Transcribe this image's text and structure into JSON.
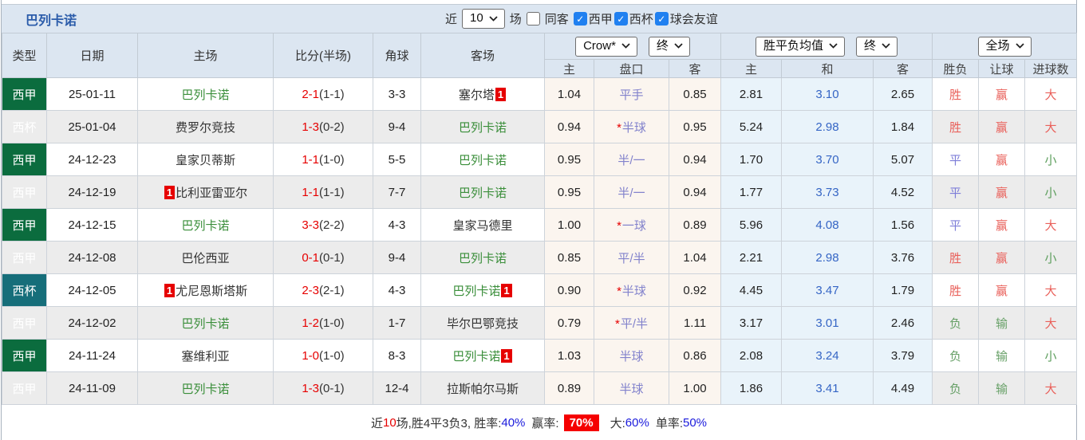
{
  "title": "巴列卡诺",
  "topbar": {
    "recent_label": "近",
    "recent_count": "10",
    "games_label": "场",
    "same_away_label": "同客",
    "filters": [
      {
        "label": "西甲",
        "checked": true
      },
      {
        "label": "西杯",
        "checked": true
      },
      {
        "label": "球会友谊",
        "checked": true
      }
    ]
  },
  "header": {
    "columns": [
      "类型",
      "日期",
      "主场",
      "比分(半场)",
      "角球",
      "客场"
    ],
    "odds_source_select": "Crow*",
    "odds_time_select": "终",
    "avg_select": "胜平负均值",
    "avg_time_select": "终",
    "scope_select": "全场",
    "sub_columns": [
      "主",
      "盘口",
      "客",
      "主",
      "和",
      "客",
      "胜负",
      "让球",
      "进球数"
    ]
  },
  "colors": {
    "laliga_badge": "#0b6c3e",
    "copa_badge": "#166e7a",
    "team_highlight": "#3a8e3a",
    "score_red": "#e60000",
    "handicap_text": "#8282cc",
    "avg_draw_blue": "#3565c5",
    "win_red": "#e9605a",
    "draw_blue": "#7d7dd8",
    "lose_green": "#67a067",
    "percent_blue": "#1a1adc",
    "badge_red": "#f50000"
  },
  "rows": [
    {
      "league": "西甲",
      "type": "liga",
      "date": "25-01-11",
      "home": "巴列卡诺",
      "home_hl": true,
      "home_card": "",
      "score": "2-1",
      "half": "(1-1)",
      "corners": "3-3",
      "away": "塞尔塔",
      "away_hl": false,
      "away_card": "1",
      "odds_home": "1.04",
      "handicap": "平手",
      "star": false,
      "odds_away": "0.85",
      "avg_home": "2.81",
      "avg_draw": "3.10",
      "avg_away": "2.65",
      "result": "胜",
      "result_cls": "win",
      "handicap_result": "赢",
      "handicap_cls": "win",
      "goals": "大",
      "goals_cls": "big"
    },
    {
      "league": "西杯",
      "type": "copa",
      "date": "25-01-04",
      "home": "费罗尔竞技",
      "home_hl": false,
      "home_card": "",
      "score": "1-3",
      "half": "(0-2)",
      "corners": "9-4",
      "away": "巴列卡诺",
      "away_hl": true,
      "away_card": "",
      "odds_home": "0.94",
      "handicap": "半球",
      "star": true,
      "odds_away": "0.95",
      "avg_home": "5.24",
      "avg_draw": "2.98",
      "avg_away": "1.84",
      "result": "胜",
      "result_cls": "win",
      "handicap_result": "赢",
      "handicap_cls": "win",
      "goals": "大",
      "goals_cls": "big"
    },
    {
      "league": "西甲",
      "type": "liga",
      "date": "24-12-23",
      "home": "皇家贝蒂斯",
      "home_hl": false,
      "home_card": "",
      "score": "1-1",
      "half": "(1-0)",
      "corners": "5-5",
      "away": "巴列卡诺",
      "away_hl": true,
      "away_card": "",
      "odds_home": "0.95",
      "handicap": "半/一",
      "star": false,
      "odds_away": "0.94",
      "avg_home": "1.70",
      "avg_draw": "3.70",
      "avg_away": "5.07",
      "result": "平",
      "result_cls": "draw",
      "handicap_result": "赢",
      "handicap_cls": "win",
      "goals": "小",
      "goals_cls": "small"
    },
    {
      "league": "西甲",
      "type": "liga",
      "date": "24-12-19",
      "home": "比利亚雷亚尔",
      "home_hl": false,
      "home_card": "1",
      "score": "1-1",
      "half": "(1-1)",
      "corners": "7-7",
      "away": "巴列卡诺",
      "away_hl": true,
      "away_card": "",
      "odds_home": "0.95",
      "handicap": "半/一",
      "star": false,
      "odds_away": "0.94",
      "avg_home": "1.77",
      "avg_draw": "3.73",
      "avg_away": "4.52",
      "result": "平",
      "result_cls": "draw",
      "handicap_result": "赢",
      "handicap_cls": "win",
      "goals": "小",
      "goals_cls": "small"
    },
    {
      "league": "西甲",
      "type": "liga",
      "date": "24-12-15",
      "home": "巴列卡诺",
      "home_hl": true,
      "home_card": "",
      "score": "3-3",
      "half": "(2-2)",
      "corners": "4-3",
      "away": "皇家马德里",
      "away_hl": false,
      "away_card": "",
      "odds_home": "1.00",
      "handicap": "一球",
      "star": true,
      "odds_away": "0.89",
      "avg_home": "5.96",
      "avg_draw": "4.08",
      "avg_away": "1.56",
      "result": "平",
      "result_cls": "draw",
      "handicap_result": "赢",
      "handicap_cls": "win",
      "goals": "大",
      "goals_cls": "big"
    },
    {
      "league": "西甲",
      "type": "liga",
      "date": "24-12-08",
      "home": "巴伦西亚",
      "home_hl": false,
      "home_card": "",
      "score": "0-1",
      "half": "(0-1)",
      "corners": "9-4",
      "away": "巴列卡诺",
      "away_hl": true,
      "away_card": "",
      "odds_home": "0.85",
      "handicap": "平/半",
      "star": false,
      "odds_away": "1.04",
      "avg_home": "2.21",
      "avg_draw": "2.98",
      "avg_away": "3.76",
      "result": "胜",
      "result_cls": "win",
      "handicap_result": "赢",
      "handicap_cls": "win",
      "goals": "小",
      "goals_cls": "small"
    },
    {
      "league": "西杯",
      "type": "copa",
      "date": "24-12-05",
      "home": "尤尼恩斯塔斯",
      "home_hl": false,
      "home_card": "1",
      "score": "2-3",
      "half": "(2-1)",
      "corners": "4-3",
      "away": "巴列卡诺",
      "away_hl": true,
      "away_card": "1",
      "odds_home": "0.90",
      "handicap": "半球",
      "star": true,
      "odds_away": "0.92",
      "avg_home": "4.45",
      "avg_draw": "3.47",
      "avg_away": "1.79",
      "result": "胜",
      "result_cls": "win",
      "handicap_result": "赢",
      "handicap_cls": "win",
      "goals": "大",
      "goals_cls": "big"
    },
    {
      "league": "西甲",
      "type": "liga",
      "date": "24-12-02",
      "home": "巴列卡诺",
      "home_hl": true,
      "home_card": "",
      "score": "1-2",
      "half": "(1-0)",
      "corners": "1-7",
      "away": "毕尔巴鄂竞技",
      "away_hl": false,
      "away_card": "",
      "odds_home": "0.79",
      "handicap": "平/半",
      "star": true,
      "odds_away": "1.11",
      "avg_home": "3.17",
      "avg_draw": "3.01",
      "avg_away": "2.46",
      "result": "负",
      "result_cls": "lose",
      "handicap_result": "输",
      "handicap_cls": "lose",
      "goals": "大",
      "goals_cls": "big"
    },
    {
      "league": "西甲",
      "type": "liga",
      "date": "24-11-24",
      "home": "塞维利亚",
      "home_hl": false,
      "home_card": "",
      "score": "1-0",
      "half": "(1-0)",
      "corners": "8-3",
      "away": "巴列卡诺",
      "away_hl": true,
      "away_card": "1",
      "odds_home": "1.03",
      "handicap": "半球",
      "star": false,
      "odds_away": "0.86",
      "avg_home": "2.08",
      "avg_draw": "3.24",
      "avg_away": "3.79",
      "result": "负",
      "result_cls": "lose",
      "handicap_result": "输",
      "handicap_cls": "lose",
      "goals": "小",
      "goals_cls": "small"
    },
    {
      "league": "西甲",
      "type": "liga",
      "date": "24-11-09",
      "home": "巴列卡诺",
      "home_hl": true,
      "home_card": "",
      "score": "1-3",
      "half": "(0-1)",
      "corners": "12-4",
      "away": "拉斯帕尔马斯",
      "away_hl": false,
      "away_card": "",
      "odds_home": "0.89",
      "handicap": "半球",
      "star": false,
      "odds_away": "1.00",
      "avg_home": "1.86",
      "avg_draw": "3.41",
      "avg_away": "4.49",
      "result": "负",
      "result_cls": "lose",
      "handicap_result": "输",
      "handicap_cls": "lose",
      "goals": "大",
      "goals_cls": "big"
    }
  ],
  "summary": {
    "prefix": "近",
    "count": "10",
    "mid": "场,胜4平3负3, 胜率:",
    "win_rate": "40%",
    "handicap_label": "赢率:",
    "handicap_rate": "70%",
    "big_label": "大:",
    "big_rate": "60%",
    "single_label": "单率:",
    "single_rate": "50%"
  }
}
